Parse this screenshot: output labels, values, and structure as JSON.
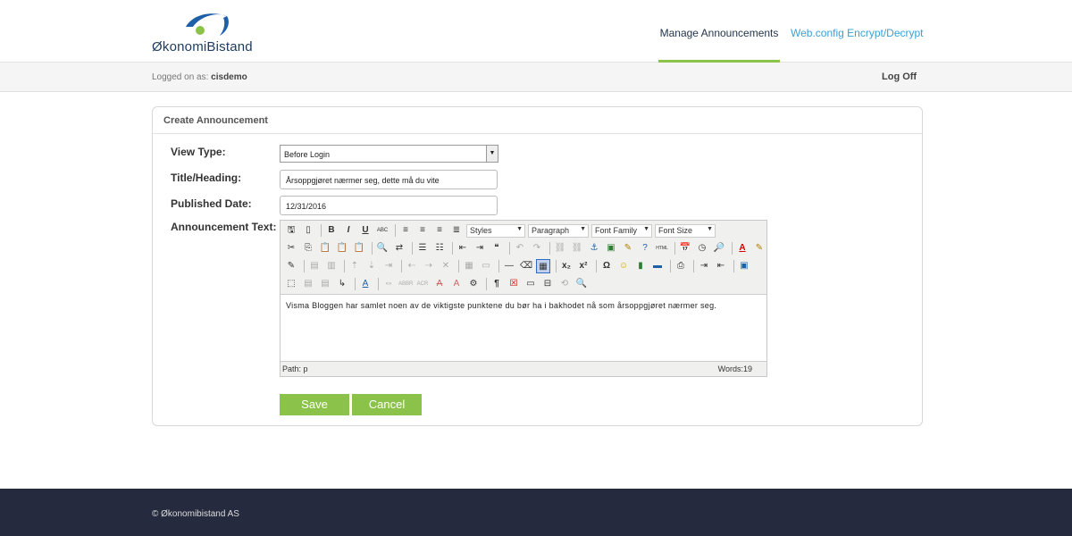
{
  "header": {
    "logo_text": "ØkonomiBistand",
    "nav": [
      "Manage Announcements",
      "Web.config Encrypt/Decrypt"
    ]
  },
  "subbar": {
    "logged_label": "Logged on as:",
    "user": "cisdemo",
    "logoff": "Log Off"
  },
  "panel": {
    "title": "Create Announcement",
    "view_type_label": "View Type:",
    "view_type_value": "Before Login",
    "title_label": "Title/Heading:",
    "title_value": "Årsoppgjøret nærmer seg, dette må du vite",
    "date_label": "Published Date:",
    "date_value": "12/31/2016",
    "text_label": "Announcement Text:"
  },
  "editor": {
    "dropdowns": [
      "Styles",
      "Paragraph",
      "Font Family",
      "Font Size"
    ],
    "content": "Visma Bloggen har samlet noen av de viktigste punktene du bør ha i bakhodet nå som årsoppgjøret nærmer seg.",
    "path": "Path: p",
    "words": "Words:19"
  },
  "buttons": {
    "save": "Save",
    "cancel": "Cancel"
  },
  "footer": {
    "text": "© Økonomibistand AS"
  },
  "colors": {
    "accent": "#8bc34a",
    "link": "#3aa0d5",
    "footer_bg": "#252a3f"
  }
}
